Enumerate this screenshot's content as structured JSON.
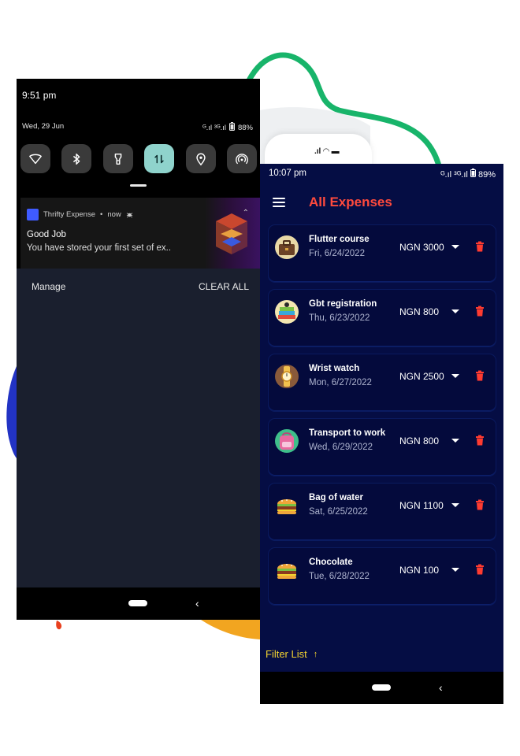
{
  "notification_shade": {
    "time": "9:51 pm",
    "date": "Wed, 29 Jun",
    "status_signal": "ᴳ.ıl ³ᴳ.ıl",
    "battery": "88%",
    "quick_settings": [
      {
        "icon": "wifi-icon",
        "active": false
      },
      {
        "icon": "bluetooth-icon",
        "active": false
      },
      {
        "icon": "flashlight-icon",
        "active": false
      },
      {
        "icon": "data-transfer-icon",
        "active": true
      },
      {
        "icon": "location-icon",
        "active": false
      },
      {
        "icon": "hotspot-icon",
        "active": false
      }
    ],
    "notification": {
      "app_name": "Thrifty Expense",
      "separator": "•",
      "when": "now",
      "title": "Good Job",
      "body": "You have stored your first set of ex.."
    },
    "manage_label": "Manage",
    "clear_all_label": "CLEAR ALL"
  },
  "app": {
    "time": "10:07 pm",
    "status_signal": "ᴳ.ıl ³ᴳ.ıl",
    "battery": "89%",
    "title": "All Expenses",
    "expenses": [
      {
        "name": "Flutter course",
        "date": "Fri, 6/24/2022",
        "amount": "NGN 3000",
        "icon": "briefcase-icon"
      },
      {
        "name": "Gbt registration",
        "date": "Thu, 6/23/2022",
        "amount": "NGN 800",
        "icon": "books-icon"
      },
      {
        "name": "Wrist watch",
        "date": "Mon, 6/27/2022",
        "amount": "NGN 2500",
        "icon": "watch-icon"
      },
      {
        "name": "Transport to work",
        "date": "Wed, 6/29/2022",
        "amount": "NGN 800",
        "icon": "backpack-icon"
      },
      {
        "name": "Bag of water",
        "date": "Sat, 6/25/2022",
        "amount": "NGN 1100",
        "icon": "burger-icon"
      },
      {
        "name": "Chocolate",
        "date": "Tue, 6/28/2022",
        "amount": "NGN 100",
        "icon": "burger-icon"
      }
    ],
    "filter_label": "Filter List",
    "filter_arrow": "↑"
  },
  "colors": {
    "app_background": "#050d44",
    "title_red": "#ff4a3d",
    "delete_red": "#ff3b30",
    "filter_yellow": "#f2d230",
    "active_tile": "#8fd3cc",
    "shade_background": "#1a1f2e"
  }
}
